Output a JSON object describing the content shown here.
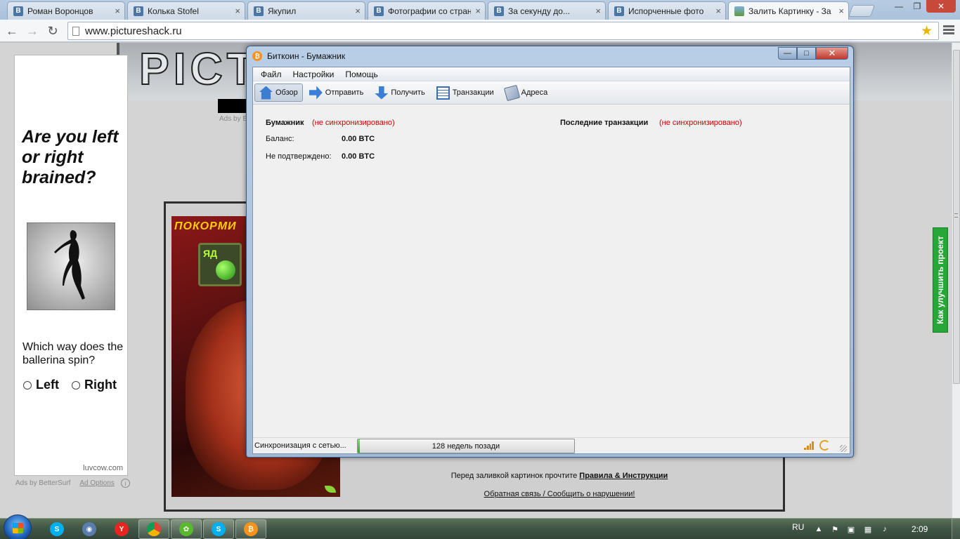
{
  "browser": {
    "tabs": [
      {
        "label": "Роман Воронцов",
        "favicon": "В"
      },
      {
        "label": "Колька Stofel",
        "favicon": "В"
      },
      {
        "label": "Якупил",
        "favicon": "В"
      },
      {
        "label": "Фотографии со стран",
        "favicon": "В"
      },
      {
        "label": "За секунду до...",
        "favicon": "В"
      },
      {
        "label": "Испорченные фото",
        "favicon": "В"
      },
      {
        "label": "Залить Картинку - За",
        "favicon": "image"
      }
    ],
    "active_tab": 6,
    "url": "www.pictureshack.ru",
    "icons": {
      "back": "arrow-left-icon",
      "forward": "arrow-right-icon",
      "reload": "reload-icon",
      "bookmark": "star-icon",
      "menu": "menu-icon"
    }
  },
  "page": {
    "logo": "PICTU",
    "ads_by_top": "Ads by B",
    "left_ad": {
      "headline": "Are you left or right brained?",
      "question": "Which way does the ballerina spin?",
      "option_left": "Left",
      "option_right": "Right",
      "domain": "luvcow.com",
      "ads_by": "Ads by BetterSurf",
      "ad_options": "Ad Options",
      "info_icon": "i"
    },
    "game_ad": {
      "title": "ПОКОРМИ",
      "poison_label": "ЯД"
    },
    "notice_prefix": "Перед заливкой картинок прочтите ",
    "notice_link": "Правила & Инструкции",
    "feedback_link": "Обратная связь / Сообщить о нарушении!",
    "feedback_tab": "Как улучшить проект"
  },
  "wallet": {
    "title": "Биткоин - Бумажник",
    "controls": {
      "minimize": "—",
      "maximize": "□",
      "close": "✕"
    },
    "menu": [
      "Файл",
      "Настройки",
      "Помощь"
    ],
    "toolbar": [
      {
        "label": "Обзор",
        "icon": "home-icon",
        "active": true
      },
      {
        "label": "Отправить",
        "icon": "send-arrow-icon",
        "active": false
      },
      {
        "label": "Получить",
        "icon": "receive-arrow-icon",
        "active": false
      },
      {
        "label": "Транзакции",
        "icon": "transactions-list-icon",
        "active": false
      },
      {
        "label": "Адреса",
        "icon": "address-book-icon",
        "active": false
      }
    ],
    "overview": {
      "wallet_heading": "Бумажник",
      "not_synced": "(не синхронизировано)",
      "balance_label": "Баланс:",
      "balance_value": "0.00 BTC",
      "unconfirmed_label": "Не подтверждено:",
      "unconfirmed_value": "0.00 BTC",
      "recent_heading": "Последние транзакции",
      "recent_not_synced": "(не синхронизировано)"
    },
    "status": {
      "sync_text": "Синхронизация с сетью...",
      "progress_text": "128 недель позади",
      "progress_fraction": 0.01
    },
    "accent": "#f7931a"
  },
  "taskbar": {
    "apps": [
      {
        "name": "skype",
        "glyph": "S",
        "color": "#00aff0",
        "open": false
      },
      {
        "name": "network-globe",
        "glyph": "◉",
        "color": "#5a7db0",
        "open": false
      },
      {
        "name": "yandex-browser",
        "glyph": "Y",
        "color": "#e52620",
        "open": false
      },
      {
        "name": "chrome",
        "glyph": "◎",
        "color": "#db4437",
        "open": true
      },
      {
        "name": "icq",
        "glyph": "✿",
        "color": "#5ab82d",
        "open": true
      },
      {
        "name": "skype-open",
        "glyph": "S",
        "color": "#00aff0",
        "open": true
      },
      {
        "name": "bitcoin",
        "glyph": "₿",
        "color": "#f7931a",
        "open": true
      }
    ],
    "language": "RU",
    "clock": "2:09"
  }
}
